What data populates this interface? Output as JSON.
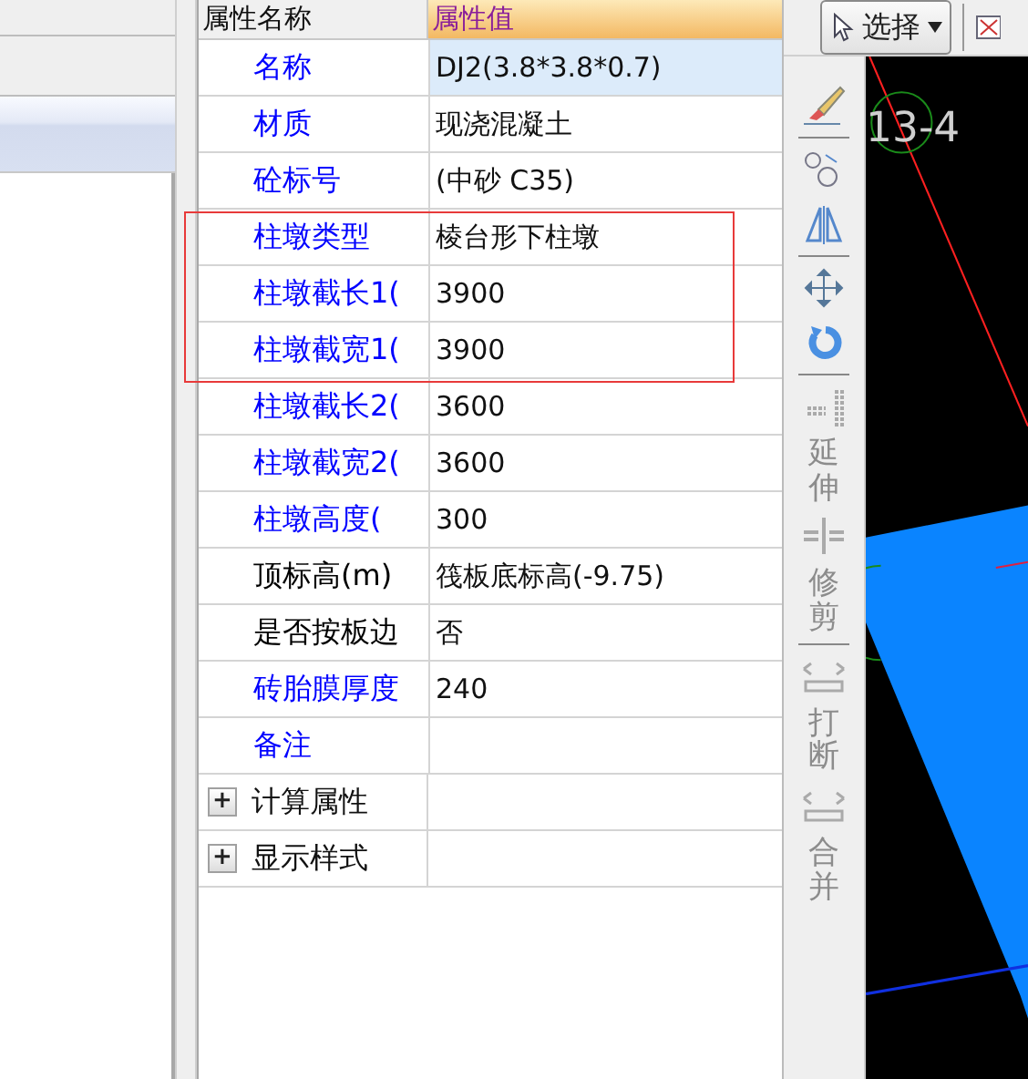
{
  "properties": {
    "columns": [
      "属性名称",
      "属性值"
    ],
    "rows": [
      {
        "name": "名称",
        "value": "DJ2(3.8*3.8*0.7)",
        "color": "#0000ff",
        "selected": true
      },
      {
        "name": "材质",
        "value": "现浇混凝土",
        "color": "#0000ff",
        "selected": false
      },
      {
        "name": "砼标号",
        "value": "(中砂 C35)",
        "color": "#0000ff",
        "selected": false
      },
      {
        "name": "柱墩类型",
        "value": "棱台形下柱墩",
        "color": "#0000ff",
        "selected": false
      },
      {
        "name": "柱墩截长1(",
        "value": "3900",
        "color": "#0000ff",
        "selected": false
      },
      {
        "name": "柱墩截宽1(",
        "value": "3900",
        "color": "#0000ff",
        "selected": false
      },
      {
        "name": "柱墩截长2(",
        "value": "3600",
        "color": "#0000ff",
        "selected": false
      },
      {
        "name": "柱墩截宽2(",
        "value": "3600",
        "color": "#0000ff",
        "selected": false
      },
      {
        "name": "柱墩高度(",
        "value": "300",
        "color": "#0000ff",
        "selected": false
      },
      {
        "name": "顶标高(m)",
        "value": "筏板底标高(-9.75)",
        "color": "#000000",
        "selected": false
      },
      {
        "name": "是否按板边",
        "value": "否",
        "color": "#000000",
        "selected": false
      },
      {
        "name": "砖胎膜厚度",
        "value": "240",
        "color": "#0000ff",
        "selected": false
      },
      {
        "name": "备注",
        "value": "",
        "color": "#0000ff",
        "selected": false
      }
    ],
    "groups": [
      {
        "label": "计算属性",
        "expanded": false,
        "symbol": "+"
      },
      {
        "label": "显示样式",
        "expanded": false,
        "symbol": "+"
      }
    ]
  },
  "toolbar": {
    "select_button": {
      "label": "选择"
    },
    "edit_tools": [
      {
        "label": "延伸",
        "disabled": true
      },
      {
        "label": "修剪",
        "disabled": true
      },
      {
        "label": "打断",
        "disabled": true
      },
      {
        "label": "合并",
        "disabled": true
      }
    ]
  },
  "canvas": {
    "labels": [
      "13-4"
    ]
  }
}
